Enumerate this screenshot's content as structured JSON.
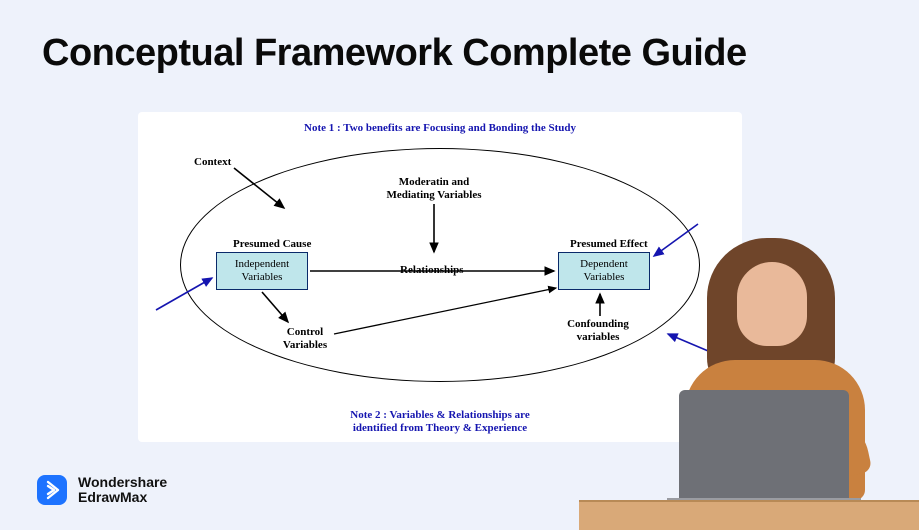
{
  "title": "Conceptual Framework Complete Guide",
  "diagram": {
    "note1": "Note 1 : Two benefits are Focusing and Bonding the Study",
    "note2": "Note 2 : Variables & Relationships are\nidentified from Theory & Experience",
    "labels": {
      "context": "Context",
      "moderating": "Moderatin and\nMediating Variables",
      "presumed_cause": "Presumed Cause",
      "presumed_effect": "Presumed Effect",
      "relationships": "Relationships",
      "control": "Control\nVariables",
      "confounding": "Confounding\nvariables"
    },
    "boxes": {
      "independent": "Independent\nVariables",
      "dependent": "Dependent\nVariables"
    }
  },
  "brand": {
    "line1": "Wondershare",
    "line2": "EdrawMax"
  }
}
